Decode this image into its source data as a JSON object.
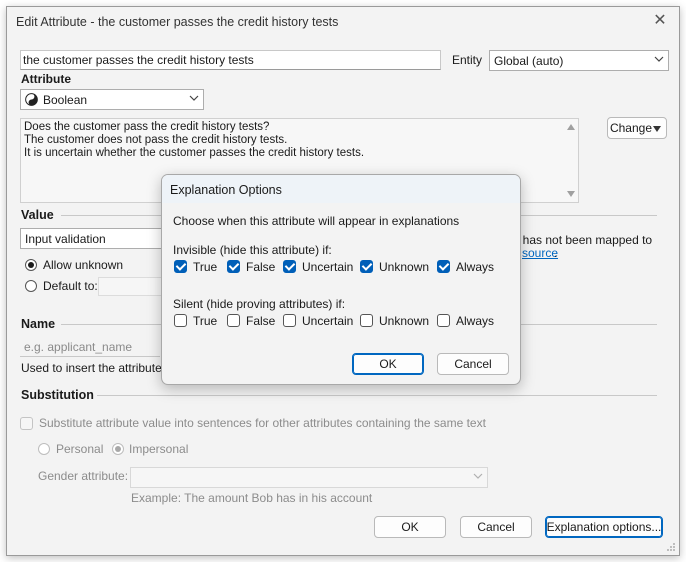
{
  "window": {
    "title": "Edit Attribute - the customer passes the credit history tests",
    "close_glyph": "✕"
  },
  "attribute_text": "the customer passes the credit history tests",
  "entity": {
    "label": "Entity",
    "value": "Global (auto)"
  },
  "attribute": {
    "heading": "Attribute",
    "type": "Boolean",
    "type_icon": "yin-yang-icon",
    "text_lines": [
      "Does the customer pass the credit history tests?",
      "The customer does not pass the credit history tests.",
      "It is uncertain whether the customer passes the credit history tests."
    ],
    "change_button": "Change"
  },
  "value": {
    "heading": "Value",
    "validation": "Input validation",
    "allow_unknown": "Allow unknown",
    "default_to": "Default to:",
    "note_line1": "t has not been mapped to",
    "note_link": "source",
    "note_end": "."
  },
  "name": {
    "heading": "Name",
    "placeholder": "e.g. applicant_name",
    "help": "Used to insert the attribute's va"
  },
  "substitution": {
    "heading": "Substitution",
    "substitute_label": "Substitute attribute value into sentences for other attributes containing the same text",
    "personal": "Personal",
    "impersonal": "Impersonal",
    "gender_label": "Gender attribute:",
    "example": "Example: The amount Bob has in his account"
  },
  "footer": {
    "ok": "OK",
    "cancel": "Cancel",
    "explanation_options": "Explanation options..."
  },
  "dialog": {
    "title": "Explanation Options",
    "prompt": "Choose when this attribute will appear in explanations",
    "invisible_heading": "Invisible (hide this attribute) if:",
    "invisible_options": [
      {
        "label": "True",
        "checked": true
      },
      {
        "label": "False",
        "checked": true
      },
      {
        "label": "Uncertain",
        "checked": true
      },
      {
        "label": "Unknown",
        "checked": true
      },
      {
        "label": "Always",
        "checked": true
      }
    ],
    "silent_heading": "Silent (hide proving attributes) if:",
    "silent_options": [
      {
        "label": "True",
        "checked": false
      },
      {
        "label": "False",
        "checked": false
      },
      {
        "label": "Uncertain",
        "checked": false
      },
      {
        "label": "Unknown",
        "checked": false
      },
      {
        "label": "Always",
        "checked": false
      }
    ],
    "ok": "OK",
    "cancel": "Cancel"
  },
  "colors": {
    "accent": "#005fb8",
    "link": "#0067c0"
  }
}
